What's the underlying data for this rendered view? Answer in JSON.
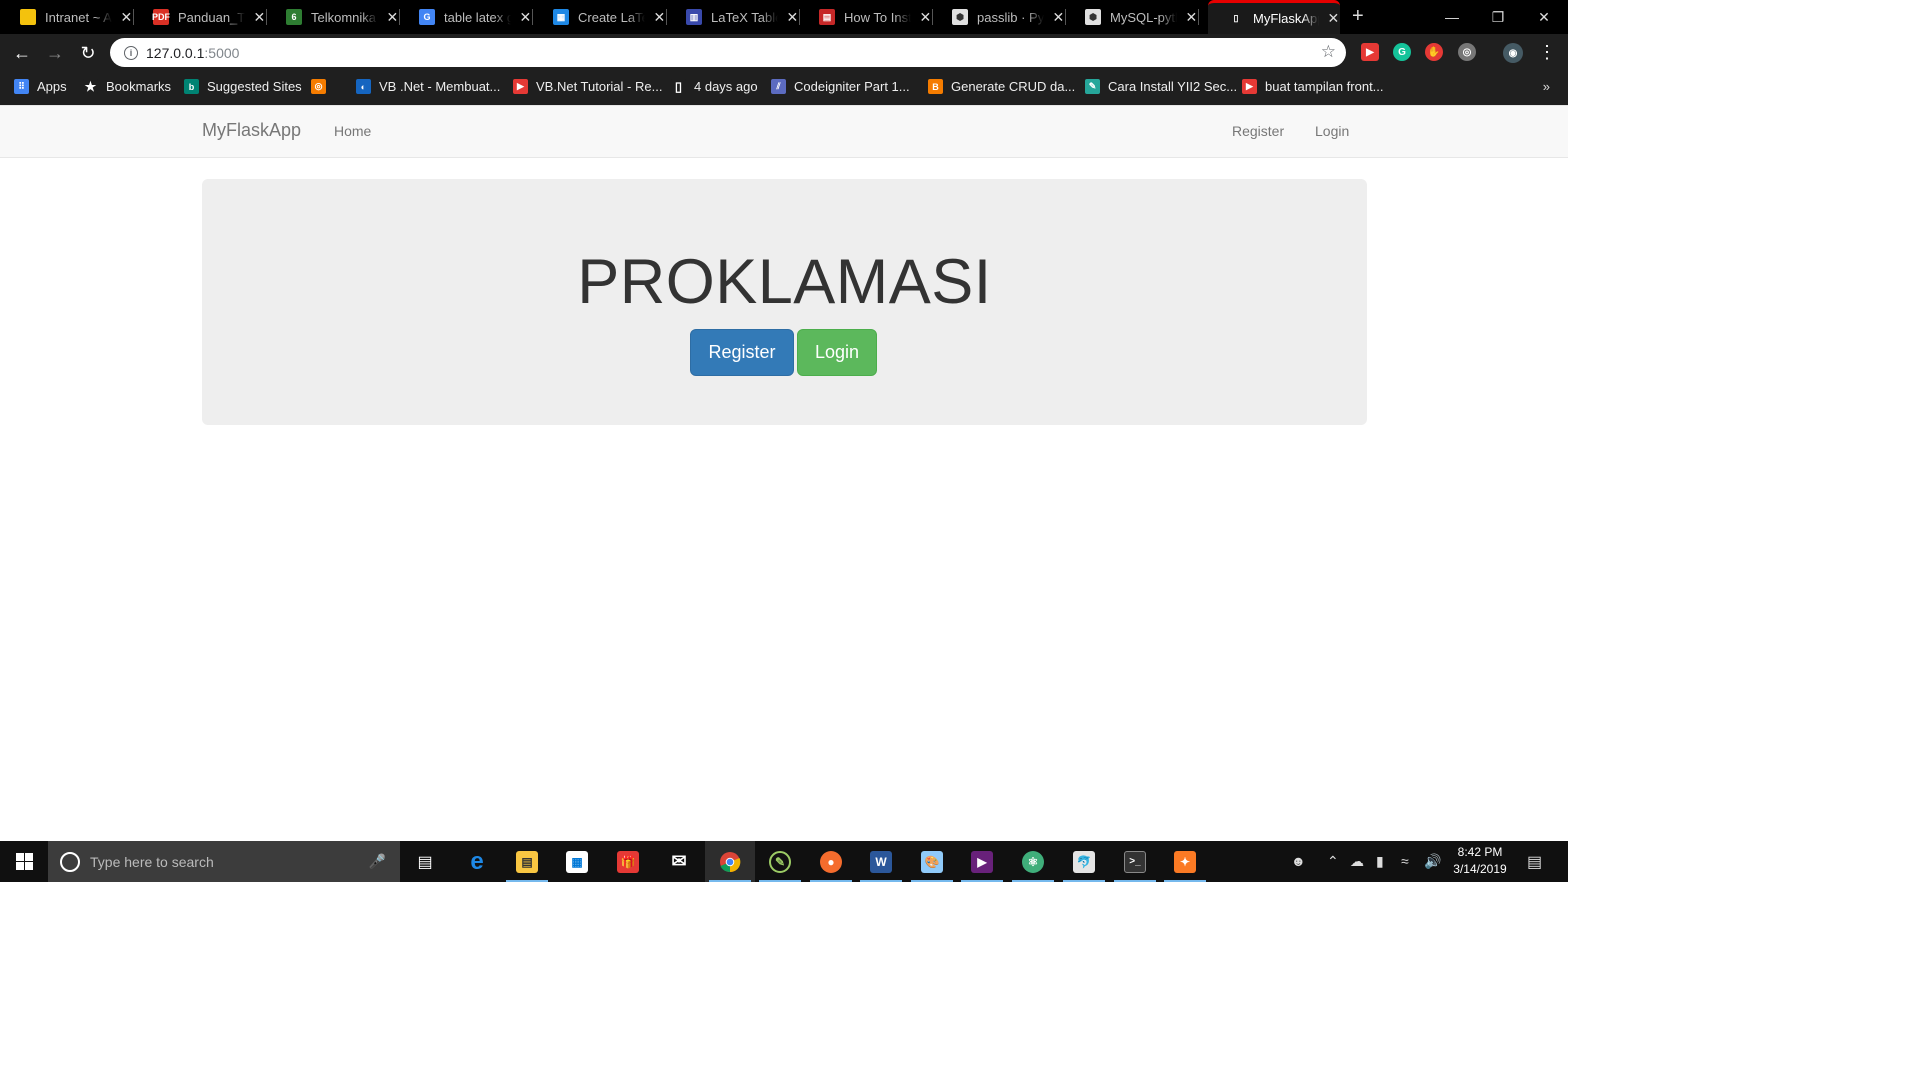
{
  "browser": {
    "tabs": [
      {
        "title": "Intranet ~ Ap",
        "icon": "document-yellow-icon",
        "color": "#f4c20d",
        "glyph": ""
      },
      {
        "title": "Panduan_Tu",
        "icon": "pdf-icon",
        "color": "#d93025",
        "glyph": "PDF"
      },
      {
        "title": "Telkomnika",
        "icon": "leaf-icon",
        "color": "#2e7d32",
        "glyph": "6"
      },
      {
        "title": "table latex g",
        "icon": "google-icon",
        "color": "#4285f4",
        "glyph": "G"
      },
      {
        "title": "Create LaTeX",
        "icon": "tables-generator-icon",
        "color": "#1e88e5",
        "glyph": "▦"
      },
      {
        "title": "LaTeX Tables",
        "icon": "chart-icon",
        "color": "#3949ab",
        "glyph": "▥"
      },
      {
        "title": "How To Insta",
        "icon": "bookmark-site-icon",
        "color": "#c62828",
        "glyph": "▤"
      },
      {
        "title": "passlib · PyPI",
        "icon": "pypi-icon",
        "color": "#e0e0e0",
        "glyph": "⬢"
      },
      {
        "title": "MySQL-pytho",
        "icon": "pypi-icon",
        "color": "#e0e0e0",
        "glyph": "⬢"
      },
      {
        "title": "MyFlaskApp",
        "icon": "blank-page-icon",
        "color": "#1a1a1a",
        "glyph": "▯"
      }
    ],
    "new_tab": "+",
    "url_host": "127.0.0.1",
    "url_port": ":5000",
    "bookmarks": [
      {
        "label": "Apps",
        "icon": "apps-grid-icon",
        "color": "#4285f4",
        "glyph": "⠿"
      },
      {
        "label": "Bookmarks",
        "icon": "star-icon",
        "color": "#1f1f1f",
        "glyph": "★"
      },
      {
        "label": "Suggested Sites",
        "icon": "bing-icon",
        "color": "#008373",
        "glyph": "b"
      },
      {
        "label": "",
        "icon": "orange-site-icon",
        "color": "#f57c00",
        "glyph": "◎"
      },
      {
        "label": "VB .Net - Membuat...",
        "icon": "vb-icon",
        "color": "#1565c0",
        "glyph": "◐"
      },
      {
        "label": "VB.Net Tutorial - Re...",
        "icon": "youtube-icon",
        "color": "#e53935",
        "glyph": "▶"
      },
      {
        "label": "4 days ago",
        "icon": "page-icon",
        "color": "#1f1f1f",
        "glyph": "▯"
      },
      {
        "label": "Codeigniter Part 1...",
        "icon": "codeigniter-icon",
        "color": "#5c6bc0",
        "glyph": "⫽"
      },
      {
        "label": "Generate CRUD da...",
        "icon": "blogger-icon",
        "color": "#f57c00",
        "glyph": "B"
      },
      {
        "label": "Cara Install YII2 Sec...",
        "icon": "pencil-site-icon",
        "color": "#26a69a",
        "glyph": "✎"
      },
      {
        "label": "buat tampilan front...",
        "icon": "youtube-icon",
        "color": "#e53935",
        "glyph": "▶"
      }
    ],
    "bookmarks_more": "»"
  },
  "page": {
    "brand": "MyFlaskApp",
    "nav_home": "Home",
    "nav_register": "Register",
    "nav_login": "Login",
    "jumbotron_title": "PROKLAMASI",
    "register_button": "Register",
    "login_button": "Login",
    "colors": {
      "primary": "#337ab7",
      "success": "#5cb85c",
      "jumbotron": "#eeeeee",
      "navbar": "#f8f8f8"
    }
  },
  "taskbar": {
    "search_placeholder": "Type here to search",
    "time": "8:42 PM",
    "date": "3/14/2019"
  }
}
